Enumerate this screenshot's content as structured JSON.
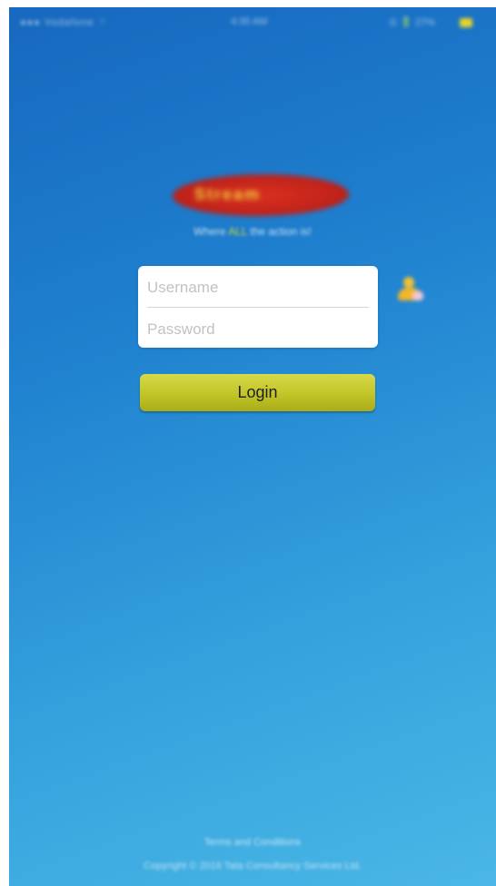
{
  "status_bar": {
    "left": "●●● Vodafone ⌔",
    "time": "4:35 AM",
    "right": "⊙ 🔋 27%"
  },
  "logo": {
    "text": "Stream"
  },
  "tagline": {
    "prefix": "Where ",
    "accent": "ALL",
    "suffix": " the action is!"
  },
  "login_form": {
    "username_placeholder": "Username",
    "password_placeholder": "Password",
    "login_label": "Login"
  },
  "footer": {
    "terms_label": "Terms and Conditions",
    "copyright": "Copyright © 2016 Tata Consultancy Services Ltd."
  },
  "colors": {
    "background_top": "#1768bf",
    "background_bottom": "#4ab7e6",
    "button": "#c2c428",
    "logo_red": "#c2231a",
    "logo_yellow": "#f2d43b"
  },
  "icons": [
    "battery-icon",
    "user-icon"
  ]
}
